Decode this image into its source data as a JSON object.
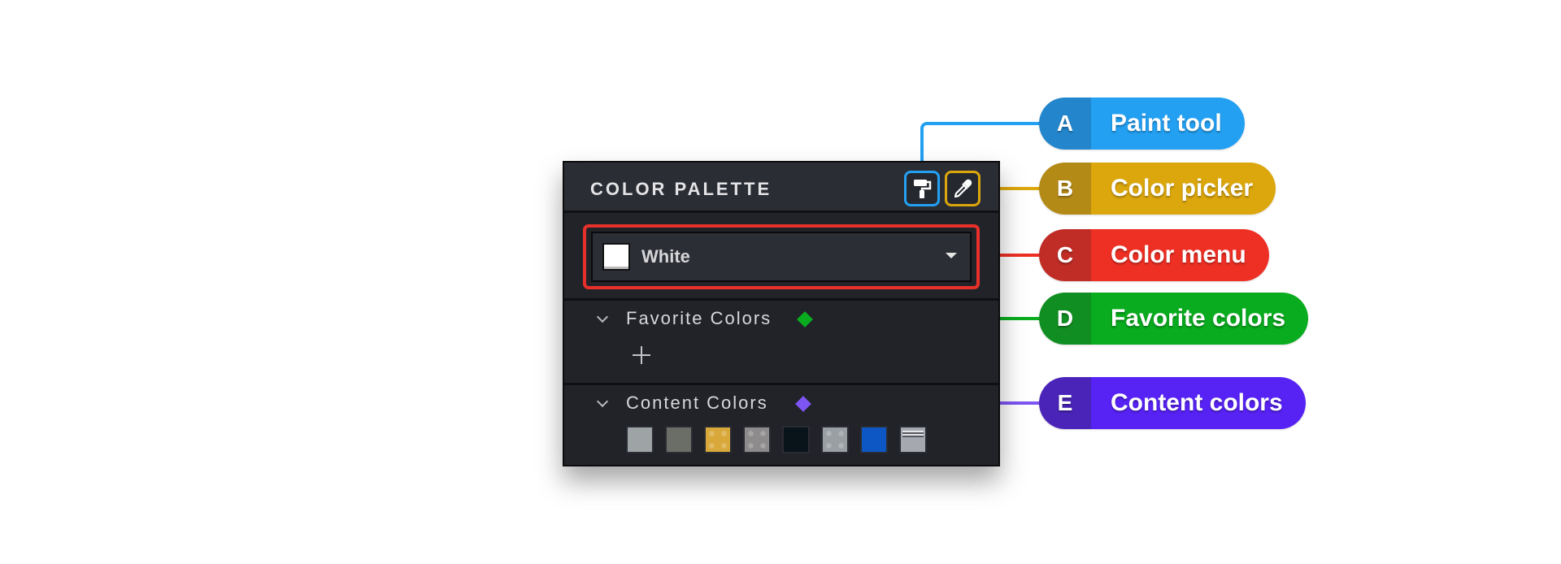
{
  "panel": {
    "title": "COLOR PALETTE",
    "tools": [
      {
        "name": "paint-tool",
        "icon": "paint-roller-icon"
      },
      {
        "name": "color-picker",
        "icon": "eyedropper-icon"
      }
    ],
    "color_menu": {
      "selected": "White",
      "swatch_color": "#ffffff"
    },
    "favorite_colors": {
      "title": "Favorite Colors",
      "add_icon": "plus-icon"
    },
    "content_colors": {
      "title": "Content Colors",
      "swatches": [
        {
          "color": "#9ea3a6",
          "pattern": "solid"
        },
        {
          "color": "#6b6e66",
          "pattern": "solid"
        },
        {
          "color": "#d9a83a",
          "pattern": "dots"
        },
        {
          "color": "#8d8b8b",
          "pattern": "dots"
        },
        {
          "color": "#08131a",
          "pattern": "solid"
        },
        {
          "color": "#9a9fa3",
          "pattern": "dots"
        },
        {
          "color": "#0d57c4",
          "pattern": "solid"
        },
        {
          "color": "#a6a8b0",
          "pattern": "lines"
        }
      ]
    }
  },
  "callouts": [
    {
      "letter": "A",
      "label": "Paint tool",
      "color": "#23a0f2",
      "dark": "#2386cc"
    },
    {
      "letter": "B",
      "label": "Color picker",
      "color": "#dca70c",
      "dark": "#b48a16"
    },
    {
      "letter": "C",
      "label": "Color menu",
      "color": "#ee2f24",
      "dark": "#c02c26"
    },
    {
      "letter": "D",
      "label": "Favorite colors",
      "color": "#08ac1e",
      "dark": "#118e22"
    },
    {
      "letter": "E",
      "label": "Content colors",
      "color": "#5722f4",
      "dark": "#4a24b8"
    }
  ]
}
